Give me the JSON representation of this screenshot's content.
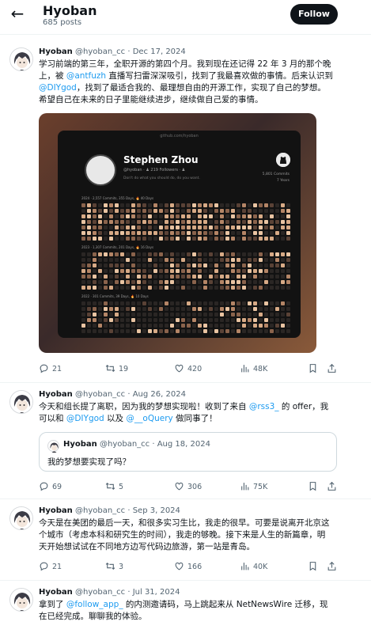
{
  "header": {
    "back_icon": "arrow-left-icon",
    "title": "Hyoban",
    "post_count": "685 posts",
    "follow_label": "Follow"
  },
  "tweets": [
    {
      "name": "Hyoban",
      "handle_date": "@hyoban_cc · Dec 17, 2024",
      "text": [
        {
          "t": "学习前端的第三年，全职开源的第四个月。我到现在还记得 22 年 3 月的那个晚上，被 "
        },
        {
          "t": "@antfuzh",
          "link": true
        },
        {
          "t": " 直播写扫雷深深吸引，找到了我最喜欢做的事情。后来认识到 "
        },
        {
          "t": "@DIYgod",
          "link": true
        },
        {
          "t": "，找到了最适合我的、最理想自由的开源工作，实现了自己的梦想。希望自己在未来的日子里能继续进步，继续做自己爱的事情。"
        }
      ],
      "media": {
        "url": "github.com/hyoban",
        "profile_name": "Stephen Zhou",
        "profile_handle": "@hyoban · ♟ 219 Followers · ♟",
        "profile_quote": "Don't do what you should do, do you want.",
        "commits": "5,801 Commits",
        "years": "7 Years",
        "rows": [
          {
            "label": "2024 · 2,557 Commits, 355 Days, 🔥 40 Days"
          },
          {
            "label": "2023 · 1,307 Commits, 201 Days, 🔥 16 Days"
          },
          {
            "label": "2022 · 301 Commits, 39 Days, 🔥 10 Days"
          }
        ]
      },
      "actions": {
        "reply": "21",
        "repost": "19",
        "like": "420",
        "views": "48K"
      }
    },
    {
      "name": "Hyoban",
      "handle_date": "@hyoban_cc · Aug 26, 2024",
      "text": [
        {
          "t": "今天和组长提了离职，因为我的梦想实现啦！收到了来自 "
        },
        {
          "t": "@rss3_",
          "link": true
        },
        {
          "t": " 的 offer，我可以和 "
        },
        {
          "t": "@DIYgod",
          "link": true
        },
        {
          "t": " 以及 "
        },
        {
          "t": "@__oQuery",
          "link": true
        },
        {
          "t": " 做同事了！"
        }
      ],
      "quote": {
        "name": "Hyoban",
        "handle_date": "@hyoban_cc · Aug 18, 2024",
        "text": "我的梦想要实现了吗？"
      },
      "actions": {
        "reply": "69",
        "repost": "5",
        "like": "306",
        "views": "75K"
      }
    },
    {
      "name": "Hyoban",
      "handle_date": "@hyoban_cc · Sep 3, 2024",
      "text": [
        {
          "t": "今天是在美团的最后一天，和很多实习生比，我走的很早。可要是说离开北京这个城市（考虑本科和研究生的时间），我走的够晚。接下来是人生的新篇章，明天开始想试试在不同地方边写代码边旅游，第一站是青岛。"
        }
      ],
      "actions": {
        "reply": "21",
        "repost": "3",
        "like": "166",
        "views": "40K"
      }
    },
    {
      "name": "Hyoban",
      "handle_date": "@hyoban_cc · Jul 31, 2024",
      "text": [
        {
          "t": "拿到了 "
        },
        {
          "t": "@follow_app_",
          "link": true
        },
        {
          "t": " 的内测邀请码，马上跳起来从 NetNewsWire 迁移，现在已经完成。聊聊我的体验。"
        }
      ]
    }
  ],
  "icons": [
    "reply-icon",
    "repost-icon",
    "like-icon",
    "views-icon",
    "bookmark-icon",
    "share-icon",
    "github-icon",
    "avatar-anime-icon"
  ],
  "colors": {
    "link": "#1d9bf0",
    "text": "#0f1419",
    "muted": "#536471",
    "follow_bg": "#0f1419"
  }
}
